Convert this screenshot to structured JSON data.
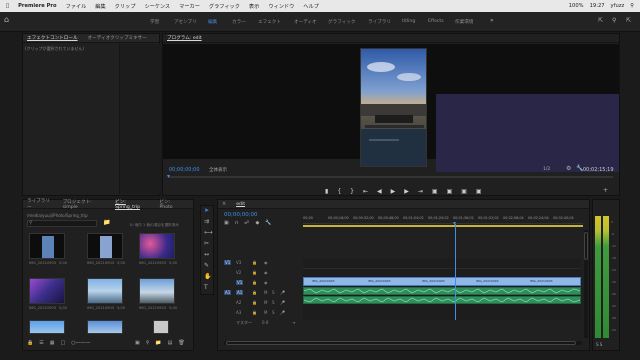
{
  "menubar": {
    "app": "Premiere Pro",
    "items": [
      "ファイル",
      "編集",
      "クリップ",
      "シーケンス",
      "マーカー",
      "グラフィック",
      "表示",
      "ウィンドウ",
      "ヘルプ"
    ],
    "battery": "100%",
    "time": "19:27",
    "user": "yfuzz"
  },
  "workspaces": [
    "学習",
    "アセンブリ",
    "編集",
    "カラー",
    "エフェクト",
    "オーディオ",
    "グラフィック",
    "ライブラリ",
    "titling",
    "Effects",
    "作業環境"
  ],
  "effect_controls": {
    "tabs": [
      "エフェクトコントロール",
      "オーディオクリップミキサー"
    ],
    "empty_msg": "(クリップが選択されていません)"
  },
  "program": {
    "tab": "プログラム: edit",
    "timecode_left": "00;00;00;00",
    "fit": "全体表示",
    "resolution": "1/2",
    "timecode_right": "00;02;15;19"
  },
  "project": {
    "tabs": [
      "ライブラリー",
      "プロジェクト: simple",
      "ビン: Spring_trip",
      "ビン: Photo"
    ],
    "path": "/media/yuuji/Photo/Spring_trip",
    "count": "10 個中 1 個の項目を選択済み",
    "items": [
      {
        "name": "IMG_20210903",
        "dur": "5;00"
      },
      {
        "name": "IMG_20210903",
        "dur": "5;00"
      },
      {
        "name": "IMG_20210903",
        "dur": "5;00"
      },
      {
        "name": "IMG_20210903",
        "dur": "5;00"
      },
      {
        "name": "IMG_20210903",
        "dur": "5;00"
      },
      {
        "name": "IMG_20210903",
        "dur": "5;00"
      },
      {
        "name": "IMG_20210903",
        "dur": "5;00"
      },
      {
        "name": "IMG_20210903",
        "dur": "5;00"
      },
      {
        "name": "IMG_20210903",
        "dur": "5;00"
      }
    ]
  },
  "timeline": {
    "tab": "edit",
    "timecode": "00;00;00;00",
    "ruler": [
      "00;00",
      "00;00;16;00",
      "00;00;32;00",
      "00;00;48;00",
      "00;01;04;02",
      "00;01;20;02",
      "00;01;36;02",
      "00;01;52;02",
      "00;02;08;04",
      "00;02;24;04",
      "00;02;40;04"
    ],
    "video_tracks": [
      "V3",
      "V2",
      "V1"
    ],
    "audio_tracks": [
      "A1",
      "A2",
      "A3"
    ],
    "master": "マスター",
    "master_val": "0.0",
    "clip_labels": [
      "IMG_20210903",
      "IMG_20210903",
      "IMG_20210903",
      "IMG_20210903",
      "IMG_20210903",
      "IMG_20210903"
    ]
  },
  "meter": {
    "labels": [
      "0",
      "-6",
      "-12",
      "-18",
      "-24",
      "-30",
      "-36",
      "-42",
      "-48",
      "-54"
    ],
    "footer": "S S"
  }
}
